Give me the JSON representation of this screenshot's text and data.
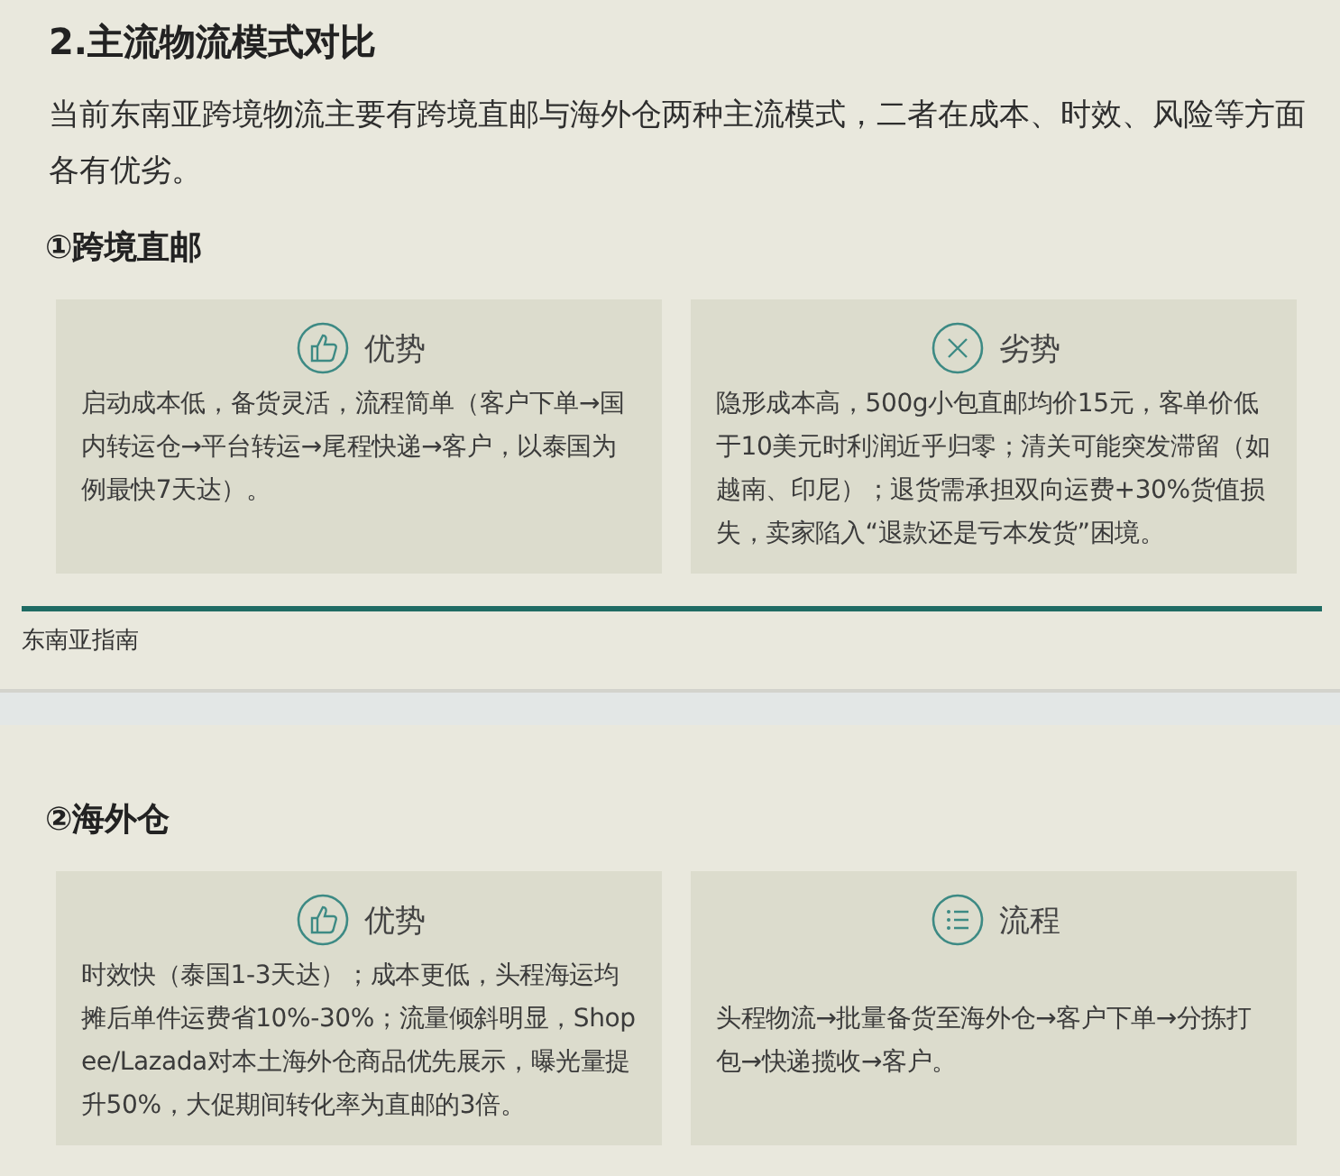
{
  "heading": "2.主流物流模式对比",
  "intro": "当前东南亚跨境物流主要有跨境直邮与海外仓两种主流模式，二者在成本、时效、风险等方面各有优劣。",
  "sections": [
    {
      "title": "①跨境直邮",
      "cards": [
        {
          "kind": "pros",
          "title": "优势",
          "text": "启动成本低，备货灵活，流程简单（客户下单→国内转运仓→平台转运→尾程快递→客户，以泰国为例最快7天达）。"
        },
        {
          "kind": "cons",
          "title": "劣势",
          "text": "隐形成本高，500g小包直邮均价15元，客单价低于10美元时利润近乎归零；清关可能突发滞留（如越南、印尼）；退货需承担双向运费+30%货值损失，卖家陷入“退款还是亏本发货”困境。"
        }
      ],
      "footer": "东南亚指南"
    },
    {
      "title": "②海外仓",
      "cards": [
        {
          "kind": "pros",
          "title": "优势",
          "text": "时效快（泰国1-3天达）；成本更低，头程海运均摊后单件运费省10%-30%；流量倾斜明显，Shopee/Lazada对本土海外仓商品优先展示，曝光量提升50%，大促期间转化率为直邮的3倍。"
        },
        {
          "kind": "steps",
          "title": "流程",
          "text": "头程物流→批量备货至海外仓→客户下单→分拣打包→快递揽收→客户。"
        }
      ]
    }
  ]
}
